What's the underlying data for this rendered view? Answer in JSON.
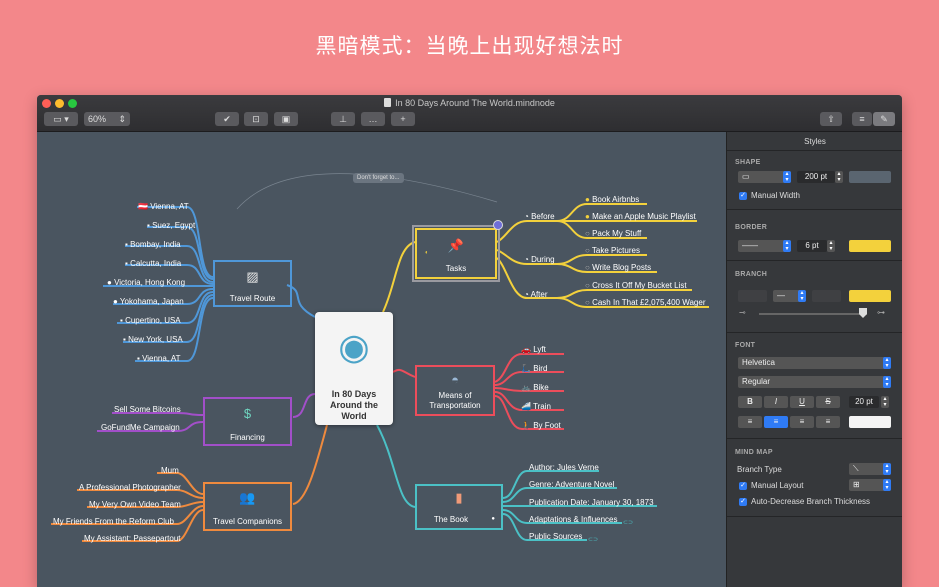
{
  "banner": "黑暗模式：当晚上出现好想法时",
  "window": {
    "title": "In 80 Days Around The World.mindnode"
  },
  "toolbar": {
    "zoom": "60%"
  },
  "map": {
    "center": {
      "line1": "In 80 Days",
      "line2": "Around the",
      "line3": "World"
    },
    "note_label": "Don't forget to...",
    "travel_route": {
      "title": "Travel Route",
      "items": [
        "Vienna, AT",
        "Suez, Egypt",
        "Bombay, India",
        "Calcutta, India",
        "Victoria, Hong Kong",
        "Yokohama, Japan",
        "Cupertino, USA",
        "New York, USA",
        "Vienna, AT"
      ]
    },
    "financing": {
      "title": "Financing",
      "items": [
        "Sell Some Bitcoins",
        "GoFundMe Campaign"
      ]
    },
    "companions": {
      "title": "Travel Companions",
      "items": [
        "Mum",
        "A Professional Photographer",
        "My Very Own Video Team",
        "My Friends From the Reform Club",
        "My Assistant: Passepartout"
      ]
    },
    "tasks": {
      "title": "Tasks",
      "groups": [
        "Before",
        "During",
        "After"
      ],
      "items": [
        "Book Airbnbs",
        "Make an Apple Music Playlist",
        "Pack My Stuff",
        "Take Pictures",
        "Write Blog Posts",
        "Cross It Off My Bucket List",
        "Cash In That £2,075,400 Wager"
      ]
    },
    "transport": {
      "title_l1": "Means of",
      "title_l2": "Transportation",
      "items": [
        "Lyft",
        "Bird",
        "Bike",
        "Train",
        "By Foot"
      ]
    },
    "book": {
      "title": "The Book",
      "items": [
        "Author: Jules Verne",
        "Genre: Adventure Novel",
        "Publication Date: January 30, 1873",
        "Adaptations & Influences",
        "Public Sources"
      ]
    }
  },
  "panel": {
    "title": "Styles",
    "shape": {
      "header": "SHAPE",
      "width": "200 pt",
      "manual_width": "Manual Width"
    },
    "border": {
      "header": "BORDER",
      "width": "6 pt"
    },
    "branch": {
      "header": "BRANCH"
    },
    "font": {
      "header": "FONT",
      "family": "Helvetica",
      "style": "Regular",
      "size": "20 pt",
      "bold": "B",
      "italic": "I",
      "underline": "U",
      "strike": "S"
    },
    "mindmap": {
      "header": "MIND MAP",
      "branch_type": "Branch Type",
      "manual_layout": "Manual Layout",
      "auto_decrease": "Auto-Decrease Branch Thickness"
    }
  },
  "colors": {
    "background": "#f3878a",
    "canvas": "#4a5560",
    "blue": "#4f97d8",
    "purple": "#a24fc9",
    "orange": "#ef8a3e",
    "yellow": "#f3d13c",
    "red": "#ec4d5b",
    "teal": "#4bc1c6"
  }
}
